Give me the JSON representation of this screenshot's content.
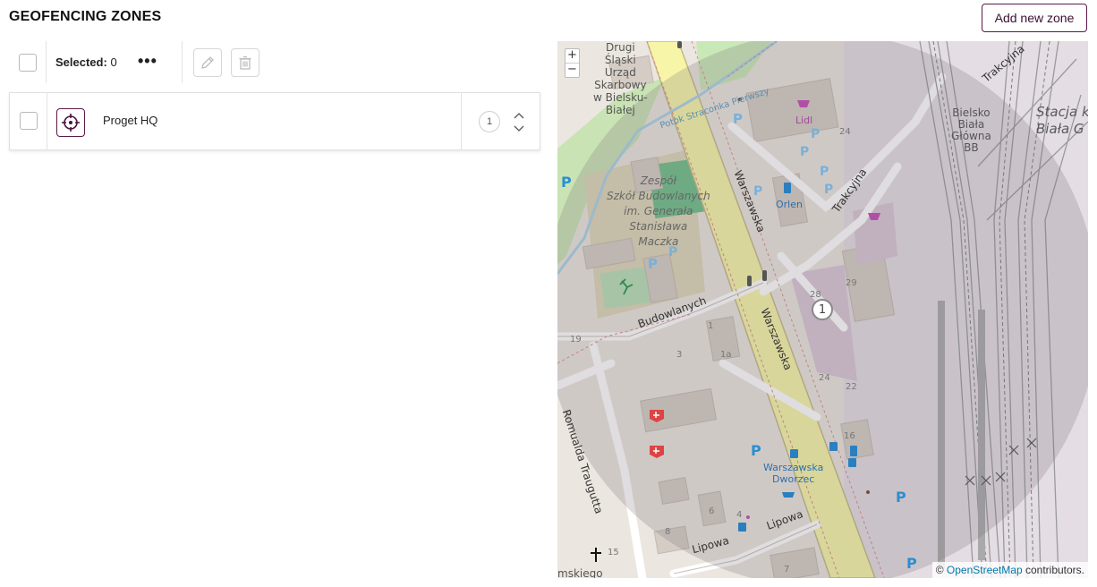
{
  "header": {
    "title": "GEOFENCING ZONES",
    "add_button_label": "Add new zone"
  },
  "toolbar": {
    "selected_label": "Selected:",
    "selected_count": "0",
    "more_label": "•••"
  },
  "zones": [
    {
      "name": "Proget HQ",
      "order": "1"
    }
  ],
  "map": {
    "zoom_in": "+",
    "zoom_out": "−",
    "marker_label": "1",
    "attribution_prefix": "©",
    "attribution_link": "OpenStreetMap",
    "attribution_suffix": "contributors.",
    "labels": {
      "drugi": [
        "Drugi",
        "Śląski",
        "Urząd",
        "Skarbowy",
        "w Bielsku-",
        "Białej"
      ],
      "potok": "Potok Straconka Pierwszy",
      "lidl": "Lidl",
      "orlen": "Orlen",
      "zespol": [
        "Zespół",
        "Szkół Budowlanych",
        "im. Generała",
        "Stanisława",
        "Maczka"
      ],
      "warszawska_1": "Warszawska",
      "warszawska_2": "Warszawska",
      "trakcyjna_1": "Trakcyjna",
      "trakcyjna_2": "Trakcyjna",
      "bielsko_biala_glowna": [
        "Bielsko",
        "Biała",
        "Główna",
        "BB"
      ],
      "stacja": [
        "Stacja k",
        "Biała G"
      ],
      "budowlanych": "Budowlanych",
      "traugutta": "Romualda Traugutta",
      "dworzec": [
        "Warszawska",
        "Dworzec"
      ],
      "lipowa_1": "Lipowa",
      "lipowa_2": "Lipowa",
      "street_partial": "mskiego",
      "parking": "P",
      "house_numbers": [
        "24",
        "28",
        "29",
        "24",
        "22",
        "16",
        "19",
        "1",
        "1a",
        "3",
        "6",
        "4",
        "8",
        "7",
        "15"
      ]
    }
  }
}
